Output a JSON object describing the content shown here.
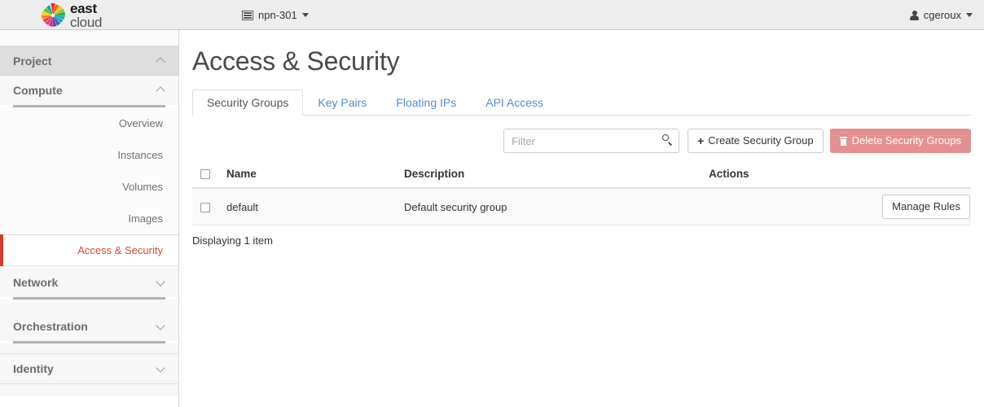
{
  "topbar": {
    "brand_line1": "east",
    "brand_line2": "cloud",
    "brand_icon": "starburst-logo-icon",
    "project_icon": "grid-list-icon",
    "project_name": "npn-301",
    "project_caret_icon": "caret-down-icon",
    "user_icon": "user-icon",
    "user_name": "cgeroux",
    "user_caret_icon": "caret-down-icon"
  },
  "sidebar": {
    "project_section": {
      "label": "Project",
      "chevron": "chevron-up-icon"
    },
    "compute_group": {
      "label": "Compute",
      "chevron": "chevron-up-icon"
    },
    "compute_items": [
      {
        "label": "Overview",
        "active": false
      },
      {
        "label": "Instances",
        "active": false
      },
      {
        "label": "Volumes",
        "active": false
      },
      {
        "label": "Images",
        "active": false
      },
      {
        "label": "Access & Security",
        "active": true
      }
    ],
    "network_group": {
      "label": "Network",
      "chevron": "chevron-down-icon"
    },
    "orchestration_group": {
      "label": "Orchestration",
      "chevron": "chevron-down-icon"
    },
    "identity_group": {
      "label": "Identity",
      "chevron": "chevron-down-icon"
    }
  },
  "main": {
    "title": "Access & Security",
    "tabs": [
      {
        "label": "Security Groups",
        "active": true
      },
      {
        "label": "Key Pairs",
        "active": false
      },
      {
        "label": "Floating IPs",
        "active": false
      },
      {
        "label": "API Access",
        "active": false
      }
    ],
    "toolbar": {
      "filter_value": "",
      "filter_placeholder": "Filter",
      "search_icon": "search-icon",
      "create_label": "Create Security Group",
      "create_icon": "plus-icon",
      "delete_label": "Delete Security Groups",
      "delete_icon": "trash-icon"
    },
    "table": {
      "columns": [
        "Name",
        "Description",
        "Actions"
      ],
      "rows": [
        {
          "name": "default",
          "description": "Default security group",
          "action_label": "Manage Rules",
          "checked": false
        }
      ]
    },
    "footer_text": "Displaying 1 item"
  },
  "colors": {
    "accent_red": "#d9392a",
    "active_link_red": "#cc4b37",
    "tab_link_blue": "#4b8fd1",
    "danger_button": "#e59090",
    "topbar_bg": "#ededed",
    "sidebar_header_bg": "#dedede"
  }
}
